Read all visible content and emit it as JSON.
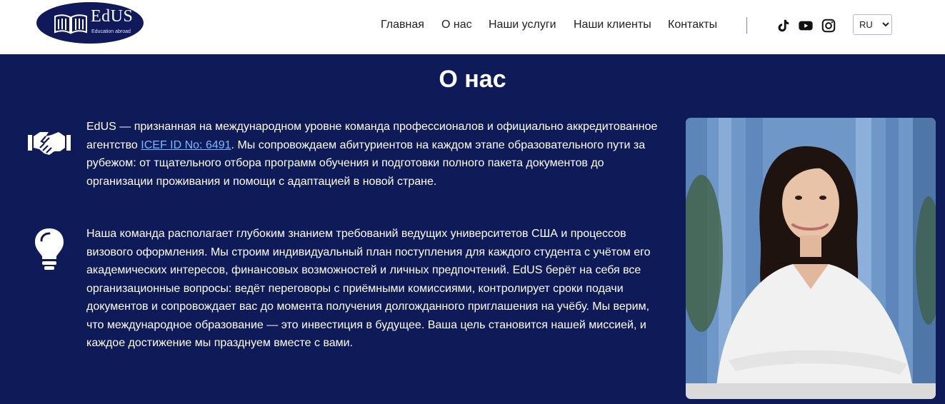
{
  "header": {
    "logo": {
      "name": "EdUS",
      "tagline": "Education abroad",
      "bg_color": "#10195a"
    },
    "nav": [
      {
        "label": "Главная"
      },
      {
        "label": "О нас"
      },
      {
        "label": "Наши услуги"
      },
      {
        "label": "Наши клиенты"
      },
      {
        "label": "Контакты"
      }
    ],
    "social_icons": [
      "tiktok-icon",
      "youtube-icon",
      "instagram-icon"
    ],
    "language": {
      "selected": "RU",
      "options": [
        "RU"
      ]
    }
  },
  "about": {
    "title": "О нас",
    "background_color": "#0f1a59",
    "paragraph1": {
      "icon": "handshake-icon",
      "before_link": "EdUS — признанная на международном уровне команда профессионалов и официально аккредитованное агентство ",
      "link_text": "ICEF ID No: 6491",
      "after_link": ". Мы сопровождаем абитуриентов на каждом этапе образовательного пути за рубежом: от тщательного отбора программ обучения и подготовки полного пакета документов до организации проживания и помощи с адаптацией в новой стране."
    },
    "paragraph2": {
      "icon": "lightbulb-icon",
      "text": "Наша команда располагает глубоким знанием требований ведущих университетов США и процессов визового оформления. Мы строим индивидуальный план поступления для каждого студента с учётом его академических интересов, финансовых возможностей и личных предпочтений. EdUS берёт на себя все организационные вопросы: ведёт переговоры с приёмными комиссиями, контролирует сроки подачи документов и сопровождает вас до момента получения долгожданного приглашения на учёбу. Мы верим, что международное образование — это инвестиция в будущее. Ваша цель становится нашей миссией, и каждое достижение мы празднуем вместе с вами."
    },
    "photo": {
      "subject": "woman-portrait",
      "colors": {
        "background": "#6f98c8",
        "shirt": "#f1f1f1",
        "hair": "#1e130f",
        "skin": "#e9c3a8"
      }
    }
  }
}
